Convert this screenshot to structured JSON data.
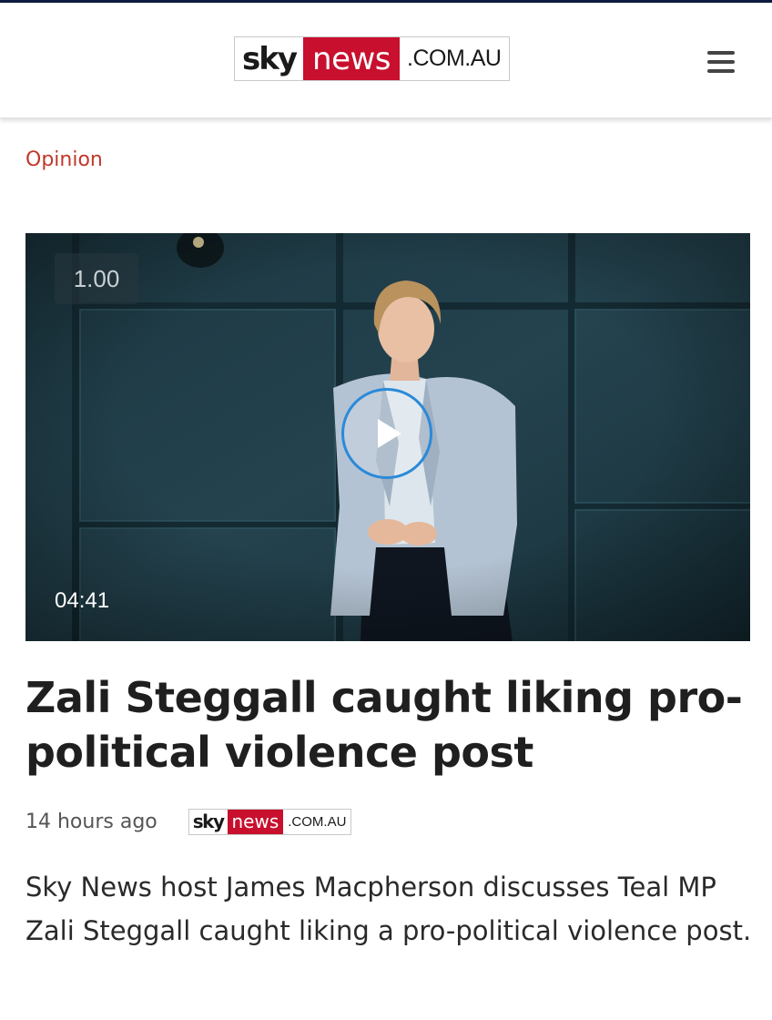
{
  "header": {
    "logo": {
      "sky": "sky",
      "news": "news",
      "domain": ".COM.AU"
    },
    "menu_icon": "hamburger-menu-icon"
  },
  "section": {
    "label": "Opinion"
  },
  "video": {
    "speed": "1.00",
    "duration": "04:41",
    "play_icon": "play-icon",
    "accent": "#2a8ad8"
  },
  "article": {
    "headline": "Zali Steggall caught liking pro-political violence post",
    "time": "14 hours ago",
    "source_logo": {
      "sky": "sky",
      "news": "news",
      "domain": ".COM.AU"
    },
    "summary": "Sky News host James Macpherson discusses Teal MP Zali Steggall caught liking a pro-political violence post."
  },
  "colors": {
    "brand_red": "#c8102e",
    "section_red": "#c0392b",
    "navy": "#0d1b3e"
  }
}
